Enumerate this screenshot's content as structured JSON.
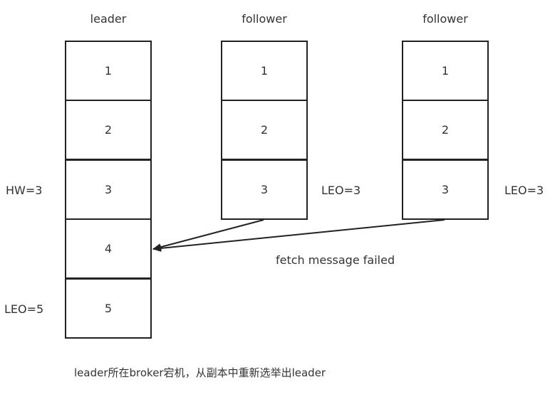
{
  "columns": [
    {
      "title": "leader",
      "cells": [
        "1",
        "2",
        "3",
        "4",
        "5"
      ]
    },
    {
      "title": "follower",
      "cells": [
        "1",
        "2",
        "3"
      ]
    },
    {
      "title": "follower",
      "cells": [
        "1",
        "2",
        "3"
      ]
    }
  ],
  "labels": {
    "leader_hw": "HW=3",
    "leader_leo": "LEO=5",
    "follower1_leo": "LEO=3",
    "follower2_leo": "LEO=3",
    "fetch_failed": "fetch message failed",
    "caption": "leader所在broker宕机，从副本中重新选举出leader"
  }
}
